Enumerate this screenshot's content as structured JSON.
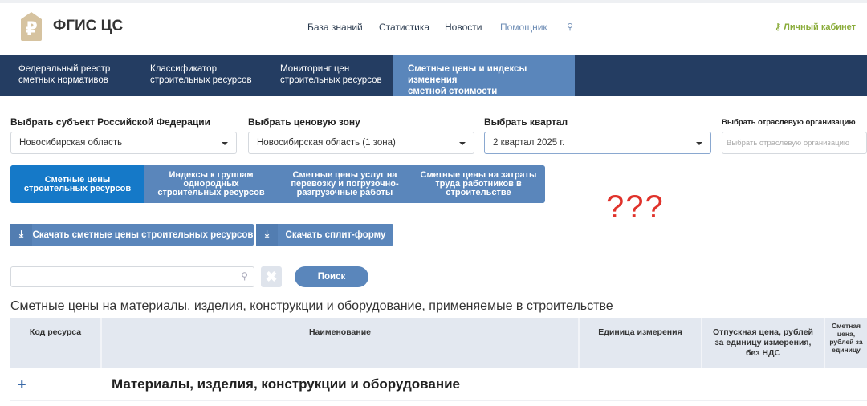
{
  "header": {
    "brand": "ФГИС ЦС",
    "logo_icon": "ruble-tag-icon",
    "nav": [
      "База знаний",
      "Статистика",
      "Новости",
      "Помощник"
    ],
    "cabinet": "Личный кабинет"
  },
  "mainnav": [
    {
      "l1": "Федеральный реестр",
      "l2": "сметных нормативов"
    },
    {
      "l1": "Классификатор",
      "l2": "строительных ресурсов"
    },
    {
      "l1": "Мониторинг цен",
      "l2": "строительных ресурсов"
    },
    {
      "l1": "Сметные цены и индексы изменения",
      "l2": "сметной стоимости строительства"
    }
  ],
  "filters": [
    {
      "label": "Выбрать субъект Российской Федерации",
      "value": "Новосибирская область"
    },
    {
      "label": "Выбрать ценовую зону",
      "value": "Новосибирская область (1 зона)"
    },
    {
      "label": "Выбрать квартал",
      "value": "2 квартал 2025 г."
    },
    {
      "label": "Выбрать отраслевую организацию",
      "placeholder": "Выбрать отраслевую организацию"
    }
  ],
  "tabs": [
    "Сметные цены строительных ресурсов",
    "Индексы к группам однородных строительных ресурсов",
    "Сметные цены услуг на перевозку и погрузочно-разгрузочные работы",
    "Сметные цены на затраты труда работников в строительстве"
  ],
  "annotation": "???",
  "downloads": [
    "Скачать сметные цены строительных ресурсов",
    "Скачать сплит-форму"
  ],
  "search": {
    "value": "",
    "button": "Поиск"
  },
  "section_title": "Сметные цены на материалы, изделия, конструкции и оборудование, применяемые в строительстве",
  "table": {
    "columns": [
      "Код ресурса",
      "Наименование",
      "Единица измерения",
      "Отпускная цена, рублей за единицу измерения, без НДС",
      "Сметная цена, рублей за единицу"
    ],
    "group_row": "Материалы, изделия, конструкции и оборудование"
  },
  "colors": {
    "nav": "#243d62",
    "accent": "#5a86bb",
    "active_tab": "#1579c8",
    "annotation": "#e0322b"
  }
}
